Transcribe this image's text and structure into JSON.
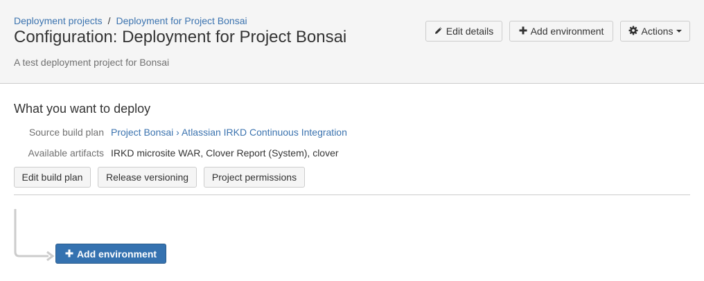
{
  "header": {
    "breadcrumbs": [
      "Deployment projects",
      "Deployment for Project Bonsai"
    ],
    "breadcrumb_separator": "/",
    "title": "Configuration: Deployment for Project Bonsai",
    "description": "A test deployment project for Bonsai",
    "buttons": {
      "edit_details": "Edit details",
      "add_environment": "Add environment",
      "actions": "Actions"
    }
  },
  "deploy_section": {
    "title": "What you want to deploy",
    "source_build_plan": {
      "label": "Source build plan",
      "project": "Project Bonsai",
      "separator": "›",
      "plan": "Atlassian IRKD Continuous Integration"
    },
    "available_artifacts": {
      "label": "Available artifacts",
      "value": "IRKD microsite WAR, Clover Report (System), clover"
    },
    "buttons": {
      "edit_build_plan": "Edit build plan",
      "release_versioning": "Release versioning",
      "project_permissions": "Project permissions"
    }
  },
  "environments": {
    "add_environment_label": "Add environment"
  },
  "icons": {
    "pencil": "pencil-icon",
    "plus": "plus-icon",
    "gear": "gear-icon",
    "caret": "chevron-down-icon"
  },
  "colors": {
    "link": "#3b73af",
    "primary": "#3572b0",
    "header_bg": "#f5f5f5",
    "connector": "#cccccc"
  }
}
